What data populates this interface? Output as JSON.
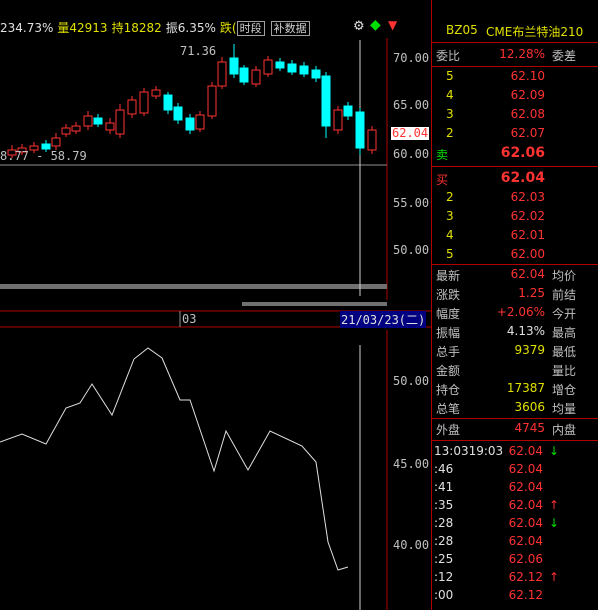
{
  "header": {
    "pct": "234.73%",
    "volume": "量42913",
    "hold": "持18282",
    "amplitude": "振6.35%",
    "fall_label": "跌(",
    "btn_timeshare": "时段",
    "btn_fill": "补数据"
  },
  "kline": {
    "high_label": "71.36",
    "low_label": "8.77 - 58.79",
    "price_tag": "62.04",
    "ticks": [
      "70.00",
      "65.00",
      "60.00",
      "55.00",
      "50.00"
    ],
    "date_mark": "03",
    "cursor_date": "21/03/23(二)"
  },
  "indicator": {
    "ticks": [
      "50.00",
      "45.00",
      "40.00"
    ]
  },
  "colors": {
    "up": "#ff3232",
    "down": "#00ffff",
    "accent": "#e0e000",
    "border": "#b00000"
  },
  "panel": {
    "code": "BZ05",
    "name": "CME布兰特油210",
    "webi_label": "委比",
    "webi_value": "12.28%",
    "weicha_label": "委差",
    "asks": [
      {
        "level": "5",
        "price": "62.10"
      },
      {
        "level": "4",
        "price": "62.09"
      },
      {
        "level": "3",
        "price": "62.08"
      },
      {
        "level": "2",
        "price": "62.07"
      }
    ],
    "sell_label": "卖",
    "sell_price": "62.06",
    "buy_label": "买",
    "buy_price": "62.04",
    "bids": [
      {
        "level": "2",
        "price": "62.03"
      },
      {
        "level": "3",
        "price": "62.02"
      },
      {
        "level": "4",
        "price": "62.01"
      },
      {
        "level": "5",
        "price": "62.00"
      }
    ],
    "stats": [
      {
        "label": "最新",
        "value": "62.04",
        "right": "均价",
        "cls": "red"
      },
      {
        "label": "涨跌",
        "value": "1.25",
        "right": "前结",
        "cls": "red"
      },
      {
        "label": "幅度",
        "value": "+2.06%",
        "right": "今开",
        "cls": "red"
      },
      {
        "label": "振幅",
        "value": "4.13%",
        "right": "最高",
        "cls": "wht"
      },
      {
        "label": "总手",
        "value": "9379",
        "right": "最低",
        "cls": "yel"
      },
      {
        "label": "金额",
        "value": "",
        "right": "量比",
        "cls": "wht"
      },
      {
        "label": "持仓",
        "value": "17387",
        "right": "增仓",
        "cls": "yel"
      },
      {
        "label": "总笔",
        "value": "3606",
        "right": "均量",
        "cls": "yel"
      }
    ],
    "outer_label": "外盘",
    "outer_value": "4745",
    "inner_label": "内盘",
    "ticks": [
      {
        "time": "13:0319:03",
        "price": "62.04",
        "arrow": "↓",
        "arrow_cls": "grn"
      },
      {
        "time": ":46",
        "price": "62.04",
        "arrow": "",
        "arrow_cls": ""
      },
      {
        "time": ":41",
        "price": "62.04",
        "arrow": "",
        "arrow_cls": ""
      },
      {
        "time": ":35",
        "price": "62.04",
        "arrow": "↑",
        "arrow_cls": "red"
      },
      {
        "time": ":28",
        "price": "62.04",
        "arrow": "↓",
        "arrow_cls": "grn"
      },
      {
        "time": ":28",
        "price": "62.04",
        "arrow": "",
        "arrow_cls": ""
      },
      {
        "time": ":25",
        "price": "62.06",
        "arrow": "",
        "arrow_cls": ""
      },
      {
        "time": ":12",
        "price": "62.12",
        "arrow": "↑",
        "arrow_cls": "red"
      },
      {
        "time": ":00",
        "price": "62.12",
        "arrow": "",
        "arrow_cls": ""
      }
    ]
  }
}
